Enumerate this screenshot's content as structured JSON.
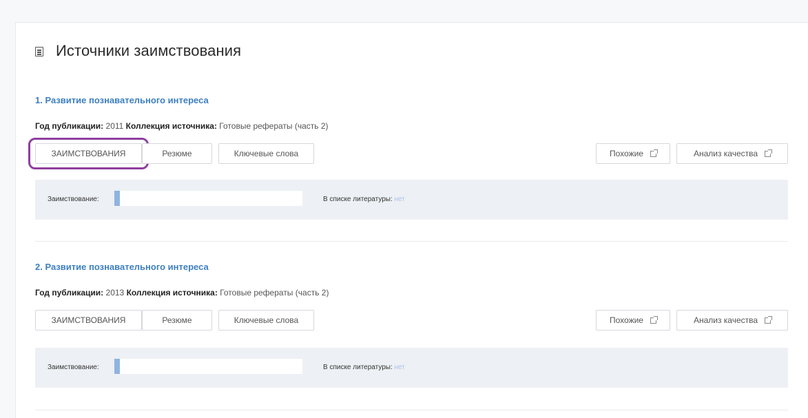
{
  "header": {
    "title": "Источники заимствования",
    "icon": "document-icon"
  },
  "labels": {
    "year": "Год публикации:",
    "collection": "Коллекция источника:",
    "borrowing": "Заимствование:",
    "in_bibliography": "В списке литературы:"
  },
  "buttons": {
    "borrowings": "ЗАИМСТВОВАНИЯ",
    "summary": "Резюме",
    "keywords": "Ключевые слова",
    "similar": "Похожие",
    "quality": "Анализ качества"
  },
  "highlight_color": "#8e3fa0",
  "sources": [
    {
      "title": "1. Развитие познавательного интереса",
      "year": "2011",
      "collection": "Готовые рефераты (часть 2)",
      "borrowing_share": 0.03,
      "in_bibliography": "нет"
    },
    {
      "title": "2. Развитие познавательного интереса",
      "year": "2013",
      "collection": "Готовые рефераты (часть 2)",
      "borrowing_share": 0.03,
      "in_bibliography": "нет"
    }
  ]
}
